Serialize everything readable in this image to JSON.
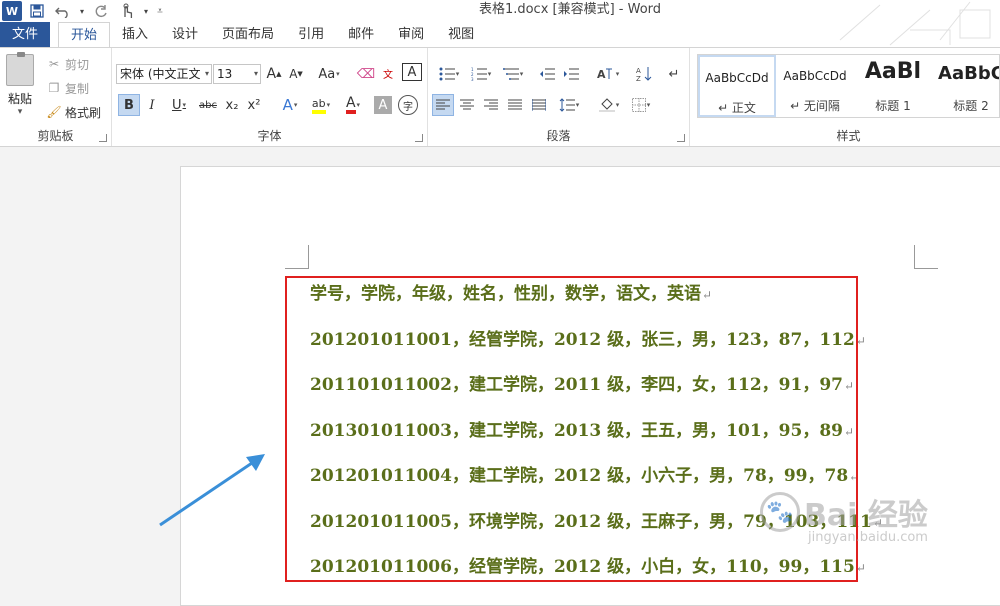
{
  "window": {
    "title": "表格1.docx [兼容模式] - Word",
    "app_icon": "W"
  },
  "qat": {
    "icons": [
      "word-logo",
      "save-icon",
      "undo-icon",
      "redo-icon",
      "touch-mode-icon",
      "customize-qat-icon"
    ]
  },
  "tabs": {
    "file": "文件",
    "home": "开始",
    "insert": "插入",
    "design": "设计",
    "layout": "页面布局",
    "references": "引用",
    "mailings": "邮件",
    "review": "审阅",
    "view": "视图"
  },
  "ribbon": {
    "clipboard": {
      "label": "剪贴板",
      "paste": "粘贴",
      "cut": "剪切",
      "copy": "复制",
      "format_painter": "格式刷"
    },
    "font": {
      "label": "字体",
      "font_name": "宋体 (中文正文",
      "font_size": "13",
      "grow": "A",
      "shrink": "A",
      "change_case": "Aa",
      "bold": "B",
      "italic": "I",
      "underline": "U",
      "strikethrough": "abc",
      "subscript": "x₂",
      "superscript": "x²",
      "text_effects": "A",
      "highlight": "ab",
      "font_color": "A",
      "shading": "A",
      "enclose": "字",
      "phonetic": "文",
      "border_char": "A"
    },
    "paragraph": {
      "label": "段落"
    },
    "styles": {
      "label": "样式",
      "items": [
        {
          "sample": "AaBbCcDd",
          "name": "↵ 正文"
        },
        {
          "sample": "AaBbCcDd",
          "name": "↵ 无间隔"
        },
        {
          "sample": "AaBl",
          "name": "标题 1"
        },
        {
          "sample": "AaBbC",
          "name": "标题 2"
        }
      ]
    }
  },
  "document": {
    "lines": [
      "学号，学院，年级，姓名，性别，数学，语文，英语",
      "201201011001，经管学院，2012 级，张三，男，123，87，112",
      "201101011002，建工学院，2011 级，李四，女，112，91，97",
      "201301011003，建工学院，2013 级，王五，男，101，95，89",
      "201201011004，建工学院，2012 级，小六子，男，78，99，78",
      "201201011005，环境学院，2012 级，王麻子，男，79，103，111",
      "201201011006，经管学院，2012 级，小白，女，110，99，115"
    ],
    "paragraph_mark": "↵"
  },
  "watermark": {
    "brand": "Bai 经验",
    "url": "jingyan.baidu.com"
  },
  "colors": {
    "accent": "#2b579a",
    "highlight_box": "#e0201f",
    "text": "#5a6e1a",
    "arrow": "#3a8fd8"
  }
}
